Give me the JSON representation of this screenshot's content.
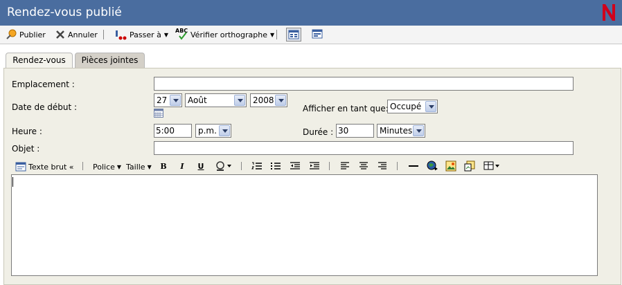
{
  "window": {
    "title": "Rendez-vous publié",
    "logo": "N"
  },
  "toolbar": {
    "publish": "Publier",
    "cancel": "Annuler",
    "goto": "Passer à",
    "spellcheck": "Vérifier orthographe",
    "spell_icon_text": "ABC"
  },
  "tabs": [
    {
      "label": "Rendez-vous"
    },
    {
      "label": "Pièces jointes"
    }
  ],
  "form": {
    "location_label": "Emplacement :",
    "location_value": "",
    "start_date_label": "Date de début :",
    "day": "27",
    "month": "Août",
    "year": "2008",
    "show_as_label": "Afficher en tant que:",
    "show_as_value": "Occupé",
    "time_label": "Heure :",
    "time_value": "5:00",
    "ampm": "p.m.",
    "duration_label": "Durée :",
    "duration_value": "30",
    "duration_unit": "Minutes",
    "subject_label": "Objet :",
    "subject_value": ""
  },
  "editor_toolbar": {
    "plain_text": "Texte brut «",
    "font": "Police",
    "size": "Taille",
    "bold": "B",
    "italic": "I",
    "underline": "U"
  },
  "colors": {
    "title_bar": "#4a6d9f",
    "logo_red": "#d0021b",
    "panel": "#f0efe6"
  }
}
